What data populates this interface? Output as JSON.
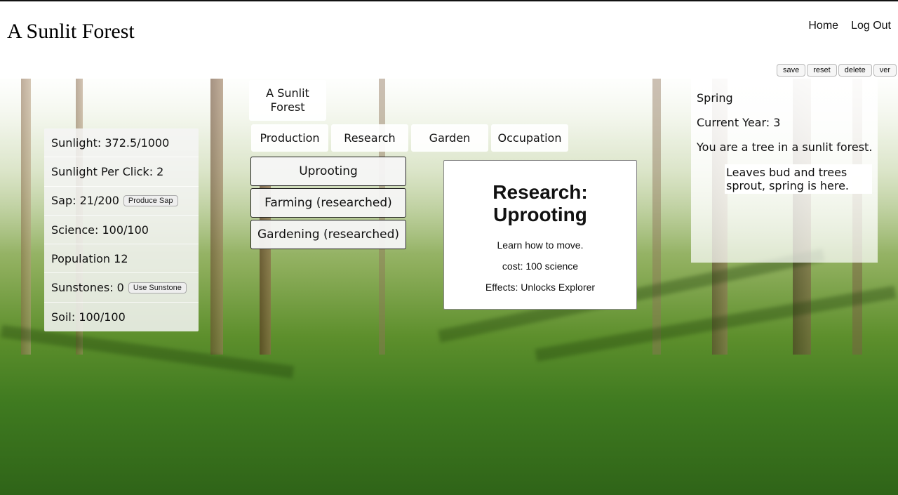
{
  "header": {
    "title": "A Sunlit Forest",
    "nav": [
      "Home",
      "Log Out"
    ]
  },
  "utility_buttons": [
    "save",
    "reset",
    "delete",
    "ver"
  ],
  "resources": [
    {
      "label": "Sunlight: 372.5/1000"
    },
    {
      "label": "Sunlight Per Click: 2"
    },
    {
      "label": "Sap: 21/200",
      "action": "Produce Sap"
    },
    {
      "label": "Science: 100/100"
    },
    {
      "label": "Population 12"
    },
    {
      "label": "Sunstones: 0",
      "action": "Use Sunstone"
    },
    {
      "label": "Soil: 100/100"
    }
  ],
  "game_tab": "A Sunlit Forest",
  "tabs": [
    "Production",
    "Research",
    "Garden",
    "Occupation"
  ],
  "research": [
    {
      "label": "Uprooting"
    },
    {
      "label": "Farming (researched)"
    },
    {
      "label": "Gardening (researched)"
    }
  ],
  "detail": {
    "title": "Research: Uprooting",
    "description": "Learn how to move.",
    "cost": "cost: 100 science",
    "effects": "Effects: Unlocks Explorer"
  },
  "log": {
    "season": "Spring",
    "year": "Current Year: 3",
    "intro": "You are a tree in a sunlit forest.",
    "event": "Leaves bud and trees sprout, spring is here."
  },
  "colors": {
    "forest_light": "#c3d3a4",
    "forest_grass": "#3f7a20",
    "panel_bg": "#f5f5f5"
  }
}
